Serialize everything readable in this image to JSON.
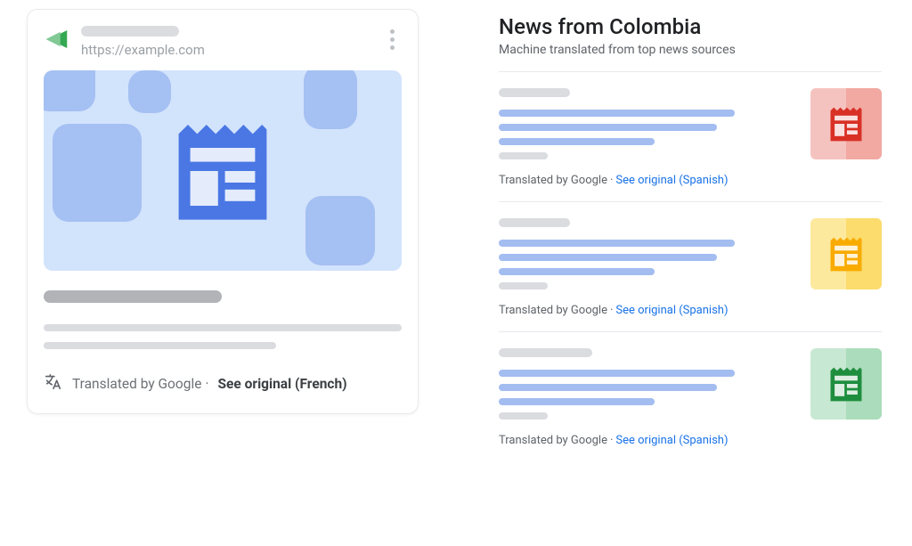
{
  "left_card": {
    "source_url": "https://example.com",
    "translated_by": "Translated by Google",
    "see_original": "See original (French)"
  },
  "news_panel": {
    "title": "News from Colombia",
    "subtitle": "Machine translated from top news sources",
    "items": [
      {
        "color": "red",
        "translated_by": "Translated by Google",
        "see_original": "See original (Spanish)"
      },
      {
        "color": "yellow",
        "translated_by": "Translated by Google",
        "see_original": "See original (Spanish)"
      },
      {
        "color": "green",
        "translated_by": "Translated by Google",
        "see_original": "See original (Spanish)"
      }
    ]
  },
  "colors": {
    "red": "#d93025",
    "yellow": "#f9ab00",
    "green": "#1e8e3e"
  }
}
